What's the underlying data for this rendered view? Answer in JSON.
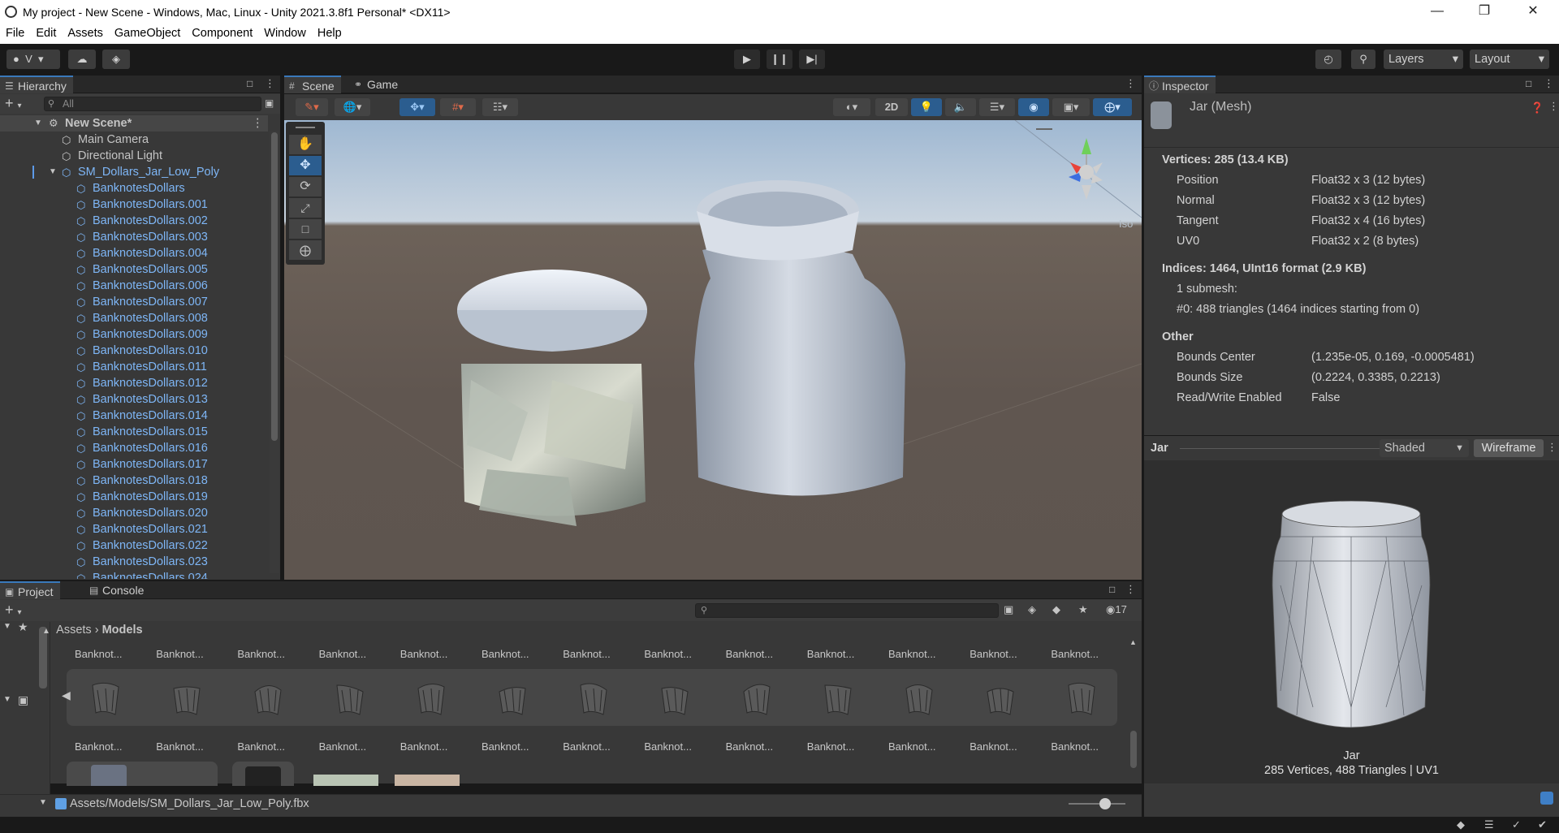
{
  "window": {
    "title": "My project - New Scene - Windows, Mac, Linux - Unity 2021.3.8f1 Personal* <DX11>"
  },
  "menu": [
    "File",
    "Edit",
    "Assets",
    "GameObject",
    "Component",
    "Window",
    "Help"
  ],
  "toolbar": {
    "account": "V",
    "layers": "Layers",
    "layout": "Layout"
  },
  "hierarchy": {
    "tab": "Hierarchy",
    "search_placeholder": "All",
    "scene": "New Scene*",
    "root_items": [
      "Main Camera",
      "Directional Light"
    ],
    "prefab": "SM_Dollars_Jar_Low_Poly",
    "children": [
      "BanknotesDollars",
      "BanknotesDollars.001",
      "BanknotesDollars.002",
      "BanknotesDollars.003",
      "BanknotesDollars.004",
      "BanknotesDollars.005",
      "BanknotesDollars.006",
      "BanknotesDollars.007",
      "BanknotesDollars.008",
      "BanknotesDollars.009",
      "BanknotesDollars.010",
      "BanknotesDollars.011",
      "BanknotesDollars.012",
      "BanknotesDollars.013",
      "BanknotesDollars.014",
      "BanknotesDollars.015",
      "BanknotesDollars.016",
      "BanknotesDollars.017",
      "BanknotesDollars.018",
      "BanknotesDollars.019",
      "BanknotesDollars.020",
      "BanknotesDollars.021",
      "BanknotesDollars.022",
      "BanknotesDollars.023",
      "BanknotesDollars.024"
    ]
  },
  "scene_view": {
    "tabs": [
      "Scene",
      "Game"
    ],
    "mode_2d": "2D",
    "gizmo_label": "Iso"
  },
  "inspector": {
    "tab": "Inspector",
    "object_name": "Jar (Mesh)",
    "vertices_header": "Vertices: 285 (13.4 KB)",
    "attributes": [
      {
        "name": "Position",
        "value": "Float32 x 3 (12 bytes)"
      },
      {
        "name": "Normal",
        "value": "Float32 x 3 (12 bytes)"
      },
      {
        "name": "Tangent",
        "value": "Float32 x 4 (16 bytes)"
      },
      {
        "name": "UV0",
        "value": "Float32 x 2 (8 bytes)"
      }
    ],
    "indices_header": "Indices: 1464, UInt16 format (2.9 KB)",
    "submesh_count": "1 submesh:",
    "submesh_detail": "#0: 488 triangles (1464 indices starting from 0)",
    "other_header": "Other",
    "other": [
      {
        "name": "Bounds Center",
        "value": "(1.235e-05, 0.169, -0.0005481)"
      },
      {
        "name": "Bounds Size",
        "value": "(0.2224, 0.3385, 0.2213)"
      },
      {
        "name": "Read/Write Enabled",
        "value": "False"
      }
    ]
  },
  "preview": {
    "name": "Jar",
    "shading": "Shaded",
    "wireframe": "Wireframe",
    "caption_name": "Jar",
    "caption_stats": "285 Vertices, 488 Triangles | UV1"
  },
  "project": {
    "tabs": [
      "Project",
      "Console"
    ],
    "breadcrumb": [
      "Assets",
      "Models"
    ],
    "hidden_count": "17",
    "thumb_label": "Banknot...",
    "path": "Assets/Models/SM_Dollars_Jar_Low_Poly.fbx"
  }
}
